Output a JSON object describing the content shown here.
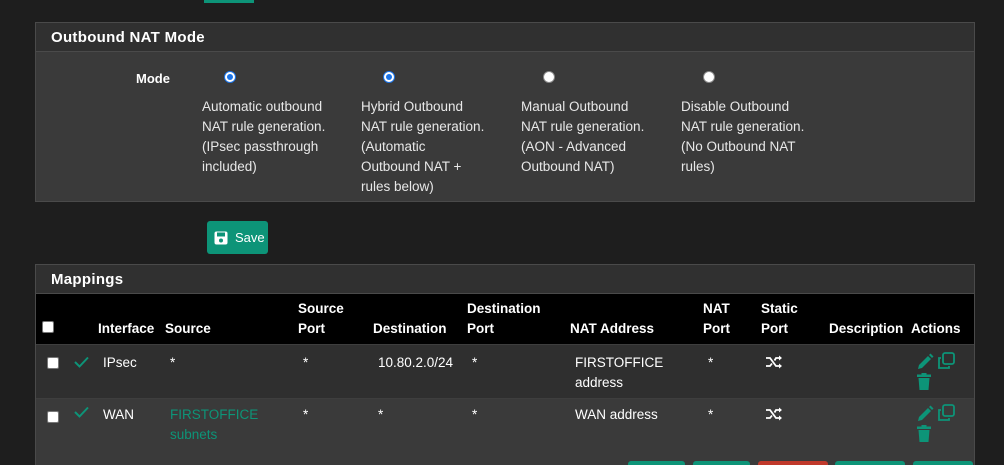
{
  "colors": {
    "accent": "#0d9478",
    "danger": "#c0392b",
    "radio_selected": "#1a73e8",
    "page_bg": "#1e1e1e"
  },
  "nat_mode": {
    "title": "Outbound NAT Mode",
    "mode_label": "Mode",
    "options": [
      {
        "lines": [
          "Automatic outbound",
          "NAT rule generation.",
          "(IPsec passthrough",
          "included)"
        ],
        "checked": true
      },
      {
        "lines": [
          "Hybrid Outbound",
          "NAT rule generation.",
          "(Automatic",
          "Outbound NAT +",
          "rules below)"
        ],
        "checked": false
      },
      {
        "lines": [
          "Manual Outbound",
          "NAT rule generation.",
          "(AON - Advanced",
          "Outbound NAT)"
        ],
        "checked": false
      },
      {
        "lines": [
          "Disable Outbound",
          "NAT rule generation.",
          "(No Outbound NAT",
          "rules)"
        ],
        "checked": false
      }
    ]
  },
  "save": {
    "label": "Save",
    "icon": "floppy-disk-icon"
  },
  "mappings": {
    "title": "Mappings",
    "headers": {
      "interface": "Interface",
      "source": "Source",
      "source_port": [
        "Source",
        "Port"
      ],
      "destination": "Destination",
      "destination_port": [
        "Destination",
        "Port"
      ],
      "nat_address": "NAT Address",
      "nat_port": [
        "NAT",
        "Port"
      ],
      "static_port": [
        "Static",
        "Port"
      ],
      "description": "Description",
      "actions": "Actions"
    },
    "rows": [
      {
        "interface": "IPsec",
        "source": "*",
        "source_is_link": false,
        "source_port": "*",
        "destination": "10.80.2.0/24",
        "destination_port": "*",
        "nat_address": [
          "FIRSTOFFICE",
          "address"
        ],
        "nat_port": "*",
        "static_port_icon": "shuffle-icon",
        "description": ""
      },
      {
        "interface": "WAN",
        "source": [
          "FIRSTOFFICE",
          "subnets"
        ],
        "source_is_link": true,
        "source_port": "*",
        "destination": "*",
        "destination_port": "*",
        "nat_address": [
          "WAN address"
        ],
        "nat_port": "*",
        "static_port_icon": "shuffle-icon",
        "description": ""
      }
    ]
  }
}
